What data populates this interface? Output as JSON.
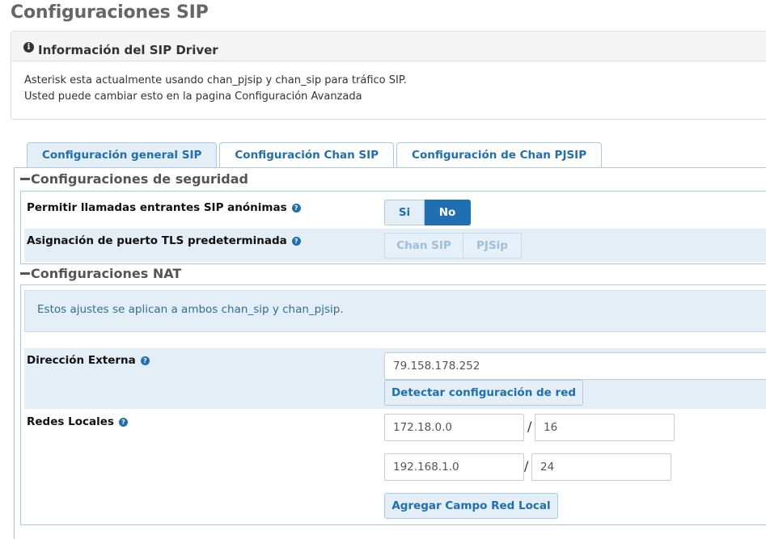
{
  "page": {
    "title": "Configuraciones SIP"
  },
  "info": {
    "heading": "Información del SIP Driver",
    "icon_glyph": "i",
    "line1": "Asterisk esta actualmente usando chan_pjsip y chan_sip para tráfico SIP.",
    "line2": "Usted puede cambiar esto en la pagina Configuración Avanzada"
  },
  "tabs": [
    {
      "label": "Configuración general SIP",
      "active": true
    },
    {
      "label": "Configuración Chan SIP",
      "active": false
    },
    {
      "label": "Configuración de Chan PJSIP",
      "active": false
    }
  ],
  "security": {
    "title": "Configuraciones de seguridad",
    "anonymous_label": "Permitir llamadas entrantes SIP anónimas",
    "anonymous_options": [
      "Si",
      "No"
    ],
    "anonymous_selected": "No",
    "tls_label": "Asignación de puerto TLS predeterminada",
    "tls_options": [
      "Chan SIP",
      "PJSip"
    ]
  },
  "nat": {
    "title": "Configuraciones NAT",
    "notice": "Estos ajustes se aplican a ambos chan_sip y chan_pjsip.",
    "external_label": "Dirección Externa",
    "external_value": "79.158.178.252",
    "detect_button": "Detectar configuración de red",
    "local_label": "Redes Locales",
    "local_networks": [
      {
        "network": "172.18.0.0",
        "cidr": "16"
      },
      {
        "network": "192.168.1.0",
        "cidr": "24"
      }
    ],
    "add_button": "Agregar Campo Red Local"
  },
  "help_glyph": "?",
  "colors": {
    "accent": "#1f6fb2",
    "panel_shade": "#e3eef7",
    "border": "#a9cbe4"
  }
}
